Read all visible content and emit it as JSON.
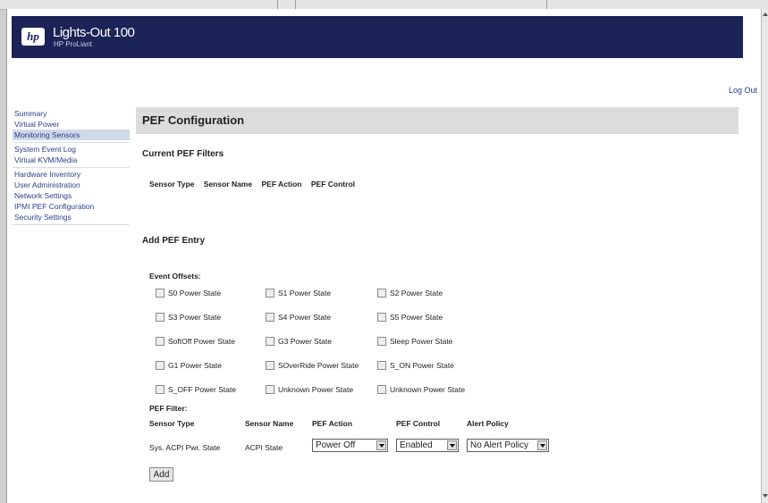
{
  "header": {
    "title": "Lights-Out 100",
    "subtitle": "HP ProLiant",
    "logo_text": "hp"
  },
  "logout_label": "Log Out",
  "sidebar": {
    "groups": [
      [
        "Summary",
        "Virtual Power",
        "Monitoring Sensors"
      ],
      [
        "System Event Log",
        "Virtual KVM/Media"
      ],
      [
        "Hardware Inventory",
        "User Administration",
        "Network Settings",
        "IPMI PEF Configuration",
        "Security Settings"
      ]
    ],
    "active": "Monitoring Sensors"
  },
  "page_title": "PEF Configuration",
  "current_filters": {
    "heading": "Current PEF Filters",
    "columns": [
      "Sensor Type",
      "Sensor Name",
      "PEF Action",
      "PEF Control"
    ]
  },
  "add_entry": {
    "heading": "Add PEF Entry",
    "offsets_label": "Event Offsets:",
    "offsets": [
      [
        "S0 Power State",
        "S1 Power State",
        "S2 Power State"
      ],
      [
        "S3 Power State",
        "S4 Power State",
        "S5 Power State"
      ],
      [
        "SoftOff Power State",
        "G3 Power State",
        "Sleep Power State"
      ],
      [
        "G1 Power State",
        "SOverRide Power State",
        "S_ON Power State"
      ],
      [
        "S_OFF Power State",
        "Unknown Power State",
        "Unknown Power State"
      ]
    ],
    "filter_label": "PEF Filter:",
    "filter_columns": [
      "Sensor Type",
      "Sensor Name",
      "PEF Action",
      "PEF Control",
      "Alert Policy"
    ],
    "sensor_type": "Sys. ACPI Pwr. State",
    "sensor_name": "ACPI State",
    "pef_action": "Power Off",
    "pef_control": "Enabled",
    "alert_policy": "No Alert Policy",
    "add_label": "Add"
  }
}
